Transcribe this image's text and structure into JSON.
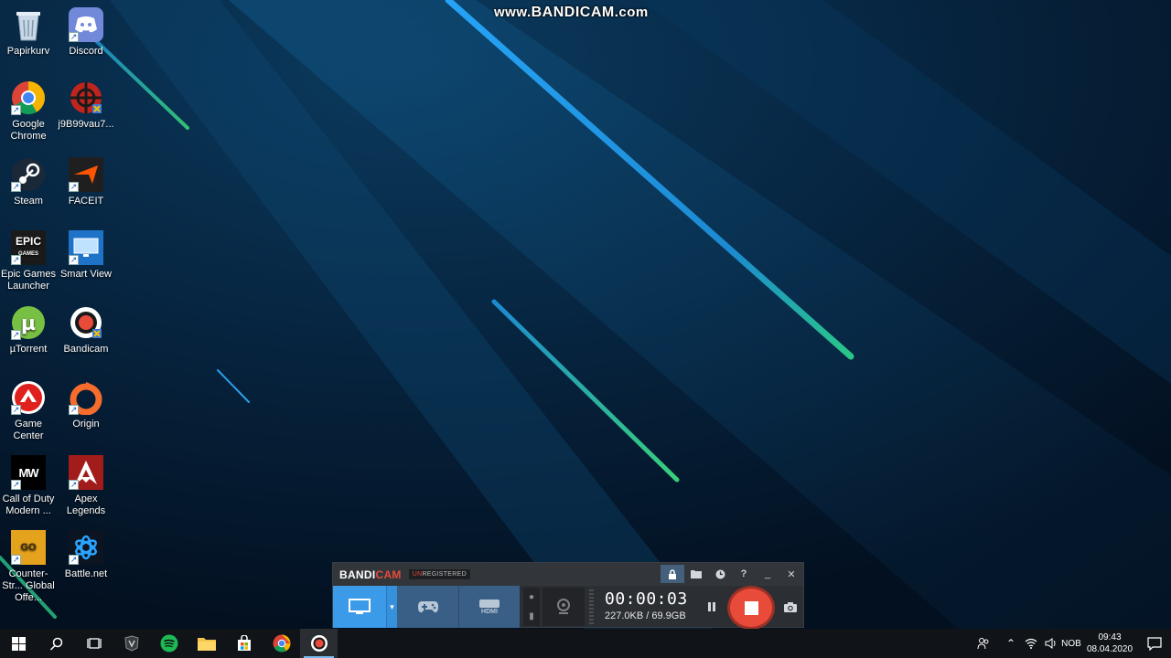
{
  "watermark": {
    "prefix": "www.",
    "brand": "BANDICAM",
    "suffix": ".com"
  },
  "desktop_icons": [
    {
      "label": "Papirkurv",
      "icon": "recycle-bin-icon",
      "shortcut": false
    },
    {
      "label": "Discord",
      "icon": "discord-icon",
      "shortcut": true
    },
    {
      "label": "Google Chrome",
      "icon": "chrome-icon",
      "shortcut": true
    },
    {
      "label": "j9B99vau7...",
      "icon": "crosshair-app-icon",
      "shortcut": false
    },
    {
      "label": "Steam",
      "icon": "steam-icon",
      "shortcut": true
    },
    {
      "label": "FACEIT",
      "icon": "faceit-icon",
      "shortcut": true
    },
    {
      "label": "Epic Games Launcher",
      "icon": "epic-games-icon",
      "shortcut": true
    },
    {
      "label": "Smart View",
      "icon": "smart-view-icon",
      "shortcut": true
    },
    {
      "label": "µTorrent",
      "icon": "utorrent-icon",
      "shortcut": true
    },
    {
      "label": "Bandicam",
      "icon": "bandicam-icon",
      "shortcut": false
    },
    {
      "label": "Game Center",
      "icon": "game-center-icon",
      "shortcut": true
    },
    {
      "label": "Origin",
      "icon": "origin-icon",
      "shortcut": true
    },
    {
      "label": "Call of Duty Modern ...",
      "icon": "cod-mw-icon",
      "shortcut": true
    },
    {
      "label": "Apex Legends",
      "icon": "apex-legends-icon",
      "shortcut": true
    },
    {
      "label": "Counter-Str... Global Offe...",
      "icon": "csgo-icon",
      "shortcut": true
    },
    {
      "label": "Battle.net",
      "icon": "battlenet-icon",
      "shortcut": true
    }
  ],
  "bandicam": {
    "logo_main": "BANDI",
    "logo_accent": "CAM",
    "unregistered_accent": "UN",
    "unregistered_rest": "REGISTERED",
    "timer": "00:00:03",
    "sizes": "227.0KB / 69.9GB",
    "mode_hdmi_label": "HDMI",
    "accent_color": "#e84b3a",
    "active_mode_color": "#3c9be8"
  },
  "taskbar": {
    "language": "NOB",
    "time": "09:43",
    "date": "08.04.2020"
  }
}
